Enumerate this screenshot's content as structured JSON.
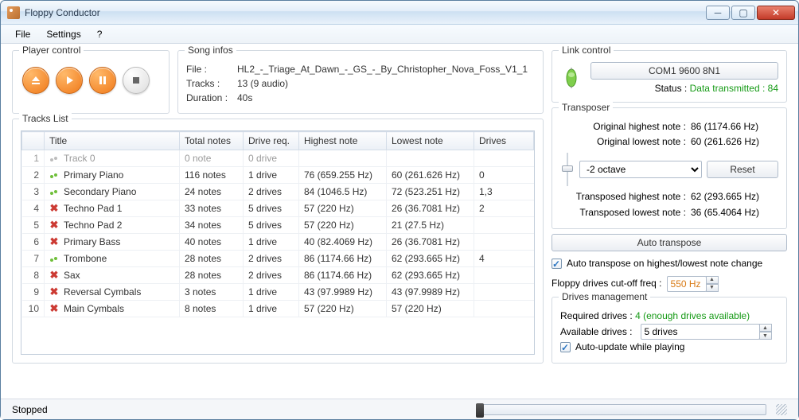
{
  "window": {
    "title": "Floppy Conductor"
  },
  "menu": {
    "file": "File",
    "settings": "Settings",
    "help": "?"
  },
  "player": {
    "legend": "Player control"
  },
  "song": {
    "legend": "Song infos",
    "file_lbl": "File :",
    "file": "HL2_-_Triage_At_Dawn_-_GS_-_By_Christopher_Nova_Foss_V1_1",
    "tracks_lbl": "Tracks :",
    "tracks": "13 (9 audio)",
    "duration_lbl": "Duration :",
    "duration": "40s"
  },
  "tracks": {
    "legend": "Tracks List",
    "headers": {
      "num": "",
      "title": "Title",
      "total": "Total notes",
      "drivereq": "Drive req.",
      "highest": "Highest note",
      "lowest": "Lowest note",
      "drives": "Drives"
    },
    "rows": [
      {
        "n": "1",
        "icon": "gray-note",
        "title": "Track 0",
        "total": "0 note",
        "drivereq": "0 drive",
        "highest": "",
        "lowest": "",
        "drives": ""
      },
      {
        "n": "2",
        "icon": "green-note",
        "title": "Primary Piano",
        "total": "116 notes",
        "drivereq": "1 drive",
        "highest": "76 (659.255 Hz)",
        "lowest": "60 (261.626 Hz)",
        "drives": "0"
      },
      {
        "n": "3",
        "icon": "green-note",
        "title": "Secondary Piano",
        "total": "24 notes",
        "drivereq": "2 drives",
        "highest": "84 (1046.5 Hz)",
        "lowest": "72 (523.251 Hz)",
        "drives": "1,3"
      },
      {
        "n": "4",
        "icon": "x",
        "title": "Techno Pad 1",
        "total": "33 notes",
        "drivereq": "5 drives",
        "highest": "57 (220 Hz)",
        "lowest": "26 (36.7081 Hz)",
        "drives": "2"
      },
      {
        "n": "5",
        "icon": "x",
        "title": "Techno Pad 2",
        "total": "34 notes",
        "drivereq": "5 drives",
        "highest": "57 (220 Hz)",
        "lowest": "21 (27.5 Hz)",
        "drives": ""
      },
      {
        "n": "6",
        "icon": "x",
        "title": "Primary Bass",
        "total": "40 notes",
        "drivereq": "1 drive",
        "highest": "40 (82.4069 Hz)",
        "lowest": "26 (36.7081 Hz)",
        "drives": ""
      },
      {
        "n": "7",
        "icon": "green-note",
        "title": "Trombone",
        "total": "28 notes",
        "drivereq": "2 drives",
        "highest": "86 (1174.66 Hz)",
        "lowest": "62 (293.665 Hz)",
        "drives": "4"
      },
      {
        "n": "8",
        "icon": "x",
        "title": "Sax",
        "total": "28 notes",
        "drivereq": "2 drives",
        "highest": "86 (1174.66 Hz)",
        "lowest": "62 (293.665 Hz)",
        "drives": ""
      },
      {
        "n": "9",
        "icon": "x",
        "title": "Reversal Cymbals",
        "total": "3 notes",
        "drivereq": "1 drive",
        "highest": "43 (97.9989 Hz)",
        "lowest": "43 (97.9989 Hz)",
        "drives": ""
      },
      {
        "n": "10",
        "icon": "x",
        "title": "Main Cymbals",
        "total": "8 notes",
        "drivereq": "1 drive",
        "highest": "57 (220 Hz)",
        "lowest": "57 (220 Hz)",
        "drives": ""
      }
    ]
  },
  "link": {
    "legend": "Link control",
    "com_btn": "COM1 9600 8N1",
    "status_lbl": "Status :",
    "status_val": "Data transmitted : 84"
  },
  "transposer": {
    "legend": "Transposer",
    "orig_high_lbl": "Original highest note :",
    "orig_high_val": "86 (1174.66 Hz)",
    "orig_low_lbl": "Original lowest note :",
    "orig_low_val": "60 (261.626 Hz)",
    "octave": "-2 octave",
    "reset": "Reset",
    "trans_high_lbl": "Transposed highest note :",
    "trans_high_val": "62 (293.665 Hz)",
    "trans_low_lbl": "Transposed lowest note :",
    "trans_low_val": "36 (65.4064 Hz)",
    "auto_btn": "Auto transpose",
    "auto_chk": "Auto transpose on highest/lowest note change",
    "cutoff_lbl": "Floppy drives cut-off freq :",
    "cutoff_val": "550 Hz"
  },
  "drives": {
    "legend": "Drives management",
    "required_lbl": "Required drives :",
    "required_val": "4 (enough drives available)",
    "available_lbl": "Available drives :",
    "available_val": "5 drives",
    "autoupdate": "Auto-update while playing"
  },
  "status": {
    "text": "Stopped"
  }
}
